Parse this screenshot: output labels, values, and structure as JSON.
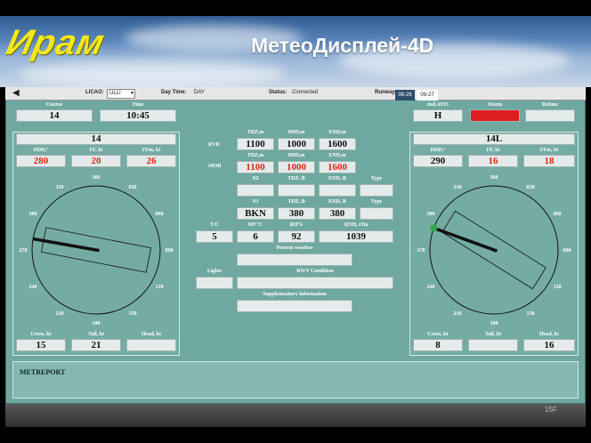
{
  "header": {
    "logo": "Ирам",
    "title": "МетеоДисплей-4D"
  },
  "toolbar": {
    "back_icon": "back-arrow-icon",
    "licao_label": "LICAO:",
    "licao_value": "ULLI",
    "daytime_label": "Day Time:",
    "daytime_value": "DAY",
    "status_label": "Status:",
    "status_value": "Connected",
    "runway_label": "Runway:",
    "runways": [
      "08-26",
      "09-27"
    ]
  },
  "top": {
    "course_label": "Course",
    "course_value": "14",
    "time_label": "Time",
    "time_value": "10:45",
    "atis_label": "Ind.ATIS",
    "atis_value": "H",
    "storm_label": "Storm",
    "retime_label": "Retime"
  },
  "left_runway": {
    "title": "14",
    "ddd_label": "DDD,°",
    "ddd": "280",
    "ff_label": "FF, kt",
    "ff": "20",
    "ffm_label": "FFm, kt",
    "ffm": "26",
    "wind_dir_deg": 280,
    "ticks": [
      "360",
      "030",
      "060",
      "090",
      "120",
      "150",
      "180",
      "210",
      "240",
      "270",
      "300",
      "330"
    ],
    "cross_label": "Cross, kt",
    "cross": "15",
    "tail_label": "Tail, kt",
    "tail": "21",
    "head_label": "Head, kt",
    "head": ""
  },
  "right_runway": {
    "title": "14L",
    "ddd_label": "DDD,°",
    "ddd": "290",
    "ff_label": "FF, kt",
    "ff": "16",
    "ffm_label": "FFm, kt",
    "ffm": "18",
    "wind_dir_deg": 290,
    "ticks": [
      "360",
      "030",
      "060",
      "090",
      "120",
      "150",
      "180",
      "210",
      "240",
      "270",
      "300",
      "330"
    ],
    "cross_label": "Cross, kt",
    "cross": "8",
    "tail_label": "Tail, kt",
    "tail": "",
    "head_label": "Head, kt",
    "head": "16"
  },
  "center": {
    "rvr_label": "RVR",
    "mor_label": "MOR",
    "tdz_label": "TDZ,m",
    "mid_label": "MID,m",
    "end_label": "END,m",
    "rvr": [
      "1100",
      "1000",
      "1600"
    ],
    "mor": [
      "1100",
      "1000",
      "1600"
    ],
    "n2_label": "N2",
    "tdzb_label": "TDZ, B",
    "endb_label": "END, B",
    "type_label": "Type",
    "n2_values": [
      "",
      "",
      "",
      ""
    ],
    "n1_label": "N1",
    "n1_values": [
      "BKN",
      "380",
      "380",
      ""
    ],
    "tc_label": "T/C",
    "tc": "5",
    "dp_label": "DP/°C",
    "dp": "6",
    "rh_label": "RH%",
    "rh": "92",
    "qnh_label": "QNH, гПа",
    "qnh": "1039",
    "present_weather_label": "Present weather",
    "lights_label": "Lights",
    "rwy_condition_label": "RWY Condition",
    "supplementary_label": "Supplementary information"
  },
  "metreport": {
    "label": "METREPORT"
  },
  "footer": {
    "page": "15F"
  },
  "colors": {
    "panel": "#6fa8a0",
    "alert": "#dd1f1f",
    "value_red": "#d9261c",
    "wind_band_green": "#2da84a",
    "logo": "#f2e81a"
  }
}
